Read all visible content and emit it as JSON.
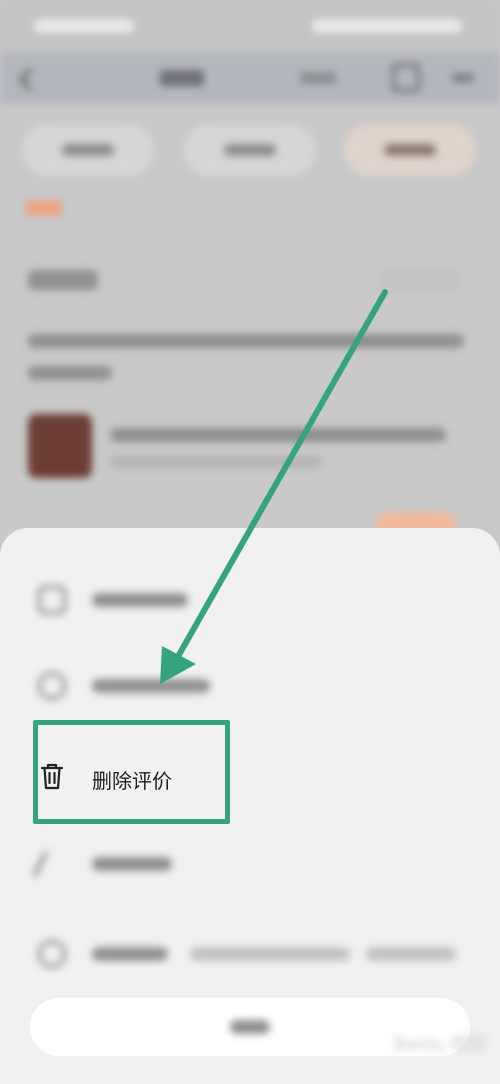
{
  "sheet": {
    "delete_item": {
      "label": "删除评价",
      "icon": "trash-icon"
    }
  },
  "colors": {
    "annotation_green": "#35a47e",
    "sheet_background": "#f1f1f1"
  }
}
